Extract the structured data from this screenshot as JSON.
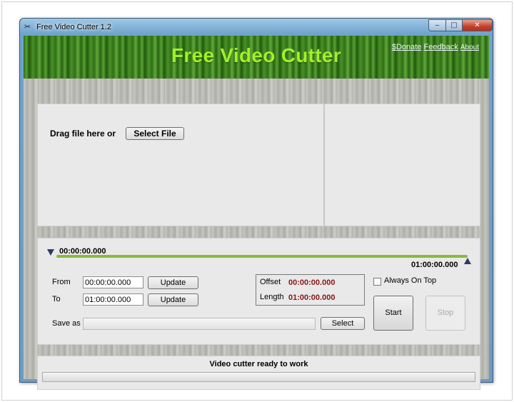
{
  "window": {
    "title": "Free Video Cutter 1.2",
    "icon": "scissors-icon",
    "controls": {
      "minimize": "‒",
      "maximize": "□",
      "close": "✕"
    }
  },
  "header": {
    "title": "Free Video Cutter",
    "links": {
      "donate": "$Donate",
      "feedback": "Feedback",
      "about": "About"
    }
  },
  "drop_area": {
    "drag_label": "Drag file here or",
    "select_file_label": "Select File"
  },
  "timeline": {
    "start_time": "00:00:00.000",
    "end_time": "01:00:00.000"
  },
  "range": {
    "from_label": "From",
    "from_value": "00:00:00.000",
    "to_label": "To",
    "to_value": "01:00:00.000",
    "update_label": "Update",
    "save_as_label": "Save as",
    "save_as_value": "",
    "select_label": "Select"
  },
  "info": {
    "offset_label": "Offset",
    "offset_value": "00:00:00.000",
    "length_label": "Length",
    "length_value": "01:00:00.000"
  },
  "options": {
    "always_on_top_label": "Always On Top",
    "always_on_top_checked": false
  },
  "actions": {
    "start_label": "Start",
    "stop_label": "Stop"
  },
  "status": {
    "message": "Video cutter ready to work",
    "progress": 0
  },
  "colors": {
    "header_title": "#a4f028",
    "time_value": "#8b1414",
    "timeline_track": "#8bb93c"
  }
}
